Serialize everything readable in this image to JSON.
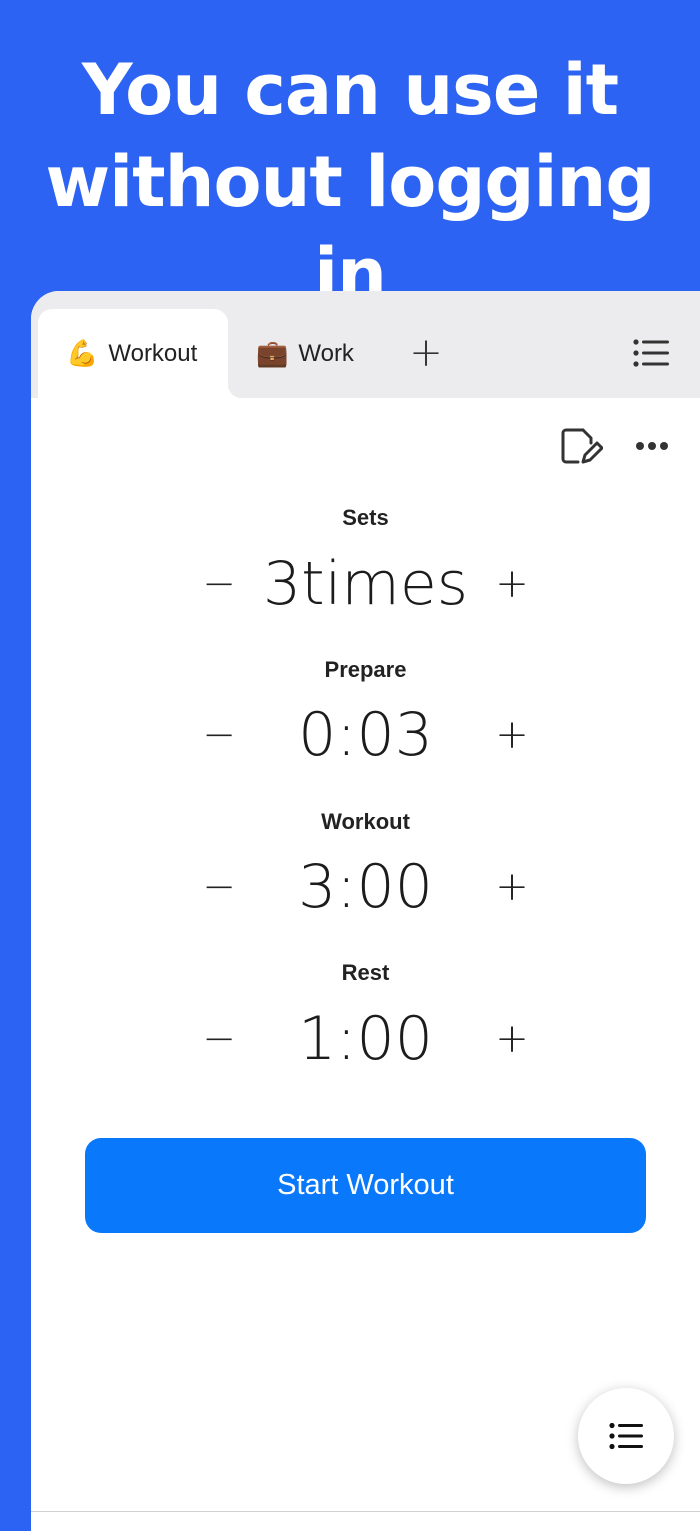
{
  "promo": {
    "headline_line1": "You can use it",
    "headline_line2": "without logging in"
  },
  "tabs": [
    {
      "emoji": "💪",
      "label": "Workout",
      "active": true
    },
    {
      "emoji": "💼",
      "label": "Work",
      "active": false
    }
  ],
  "tab_add_symbol": "+",
  "settings": [
    {
      "label": "Sets",
      "value": "3times"
    },
    {
      "label": "Prepare",
      "value": "0:03"
    },
    {
      "label": "Workout",
      "value": "3:00"
    },
    {
      "label": "Rest",
      "value": "1:00"
    }
  ],
  "stepper": {
    "minus": "−",
    "plus": "+"
  },
  "start_button": "Start Workout",
  "icons": {
    "tab_menu": "list-icon",
    "edit": "edit-note-icon",
    "more": "more-horizontal-icon",
    "fab": "list-icon"
  },
  "colors": {
    "background": "#2d63f2",
    "primary_button": "#0a78fa",
    "tabbar": "#ececee"
  }
}
